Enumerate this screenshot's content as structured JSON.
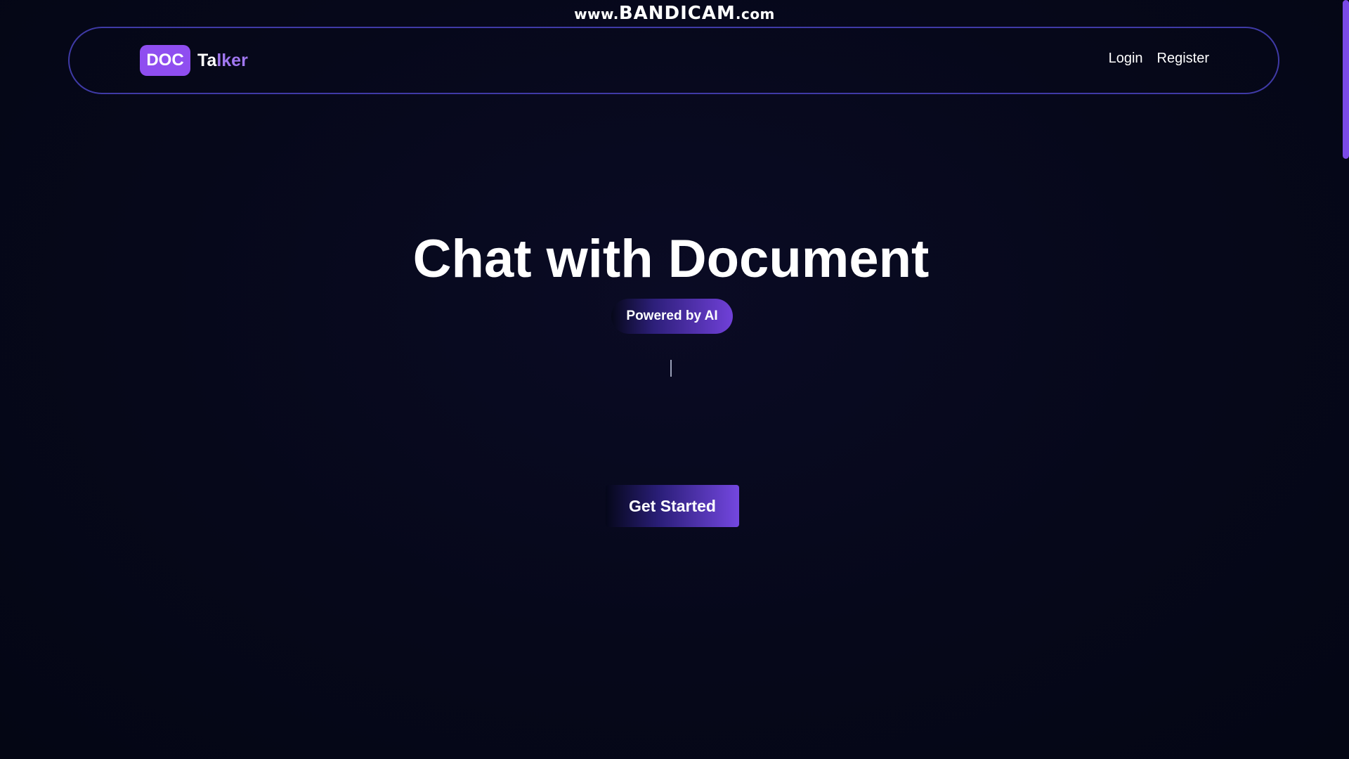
{
  "watermark": {
    "prefix": "www.",
    "brand": "BANDICAM",
    "suffix": ".com"
  },
  "header": {
    "logo_badge": "DOC",
    "logo_word_start": "Ta",
    "logo_word_accent": "lker",
    "nav": {
      "login_label": "Login",
      "register_label": "Register"
    }
  },
  "hero": {
    "title": "Chat with Document",
    "badge": "Powered by AI",
    "cta_label": "Get Started"
  },
  "colors": {
    "background": "#05071a",
    "accent": "#8f4ef0",
    "navbar_border": "#3f3aa6"
  }
}
